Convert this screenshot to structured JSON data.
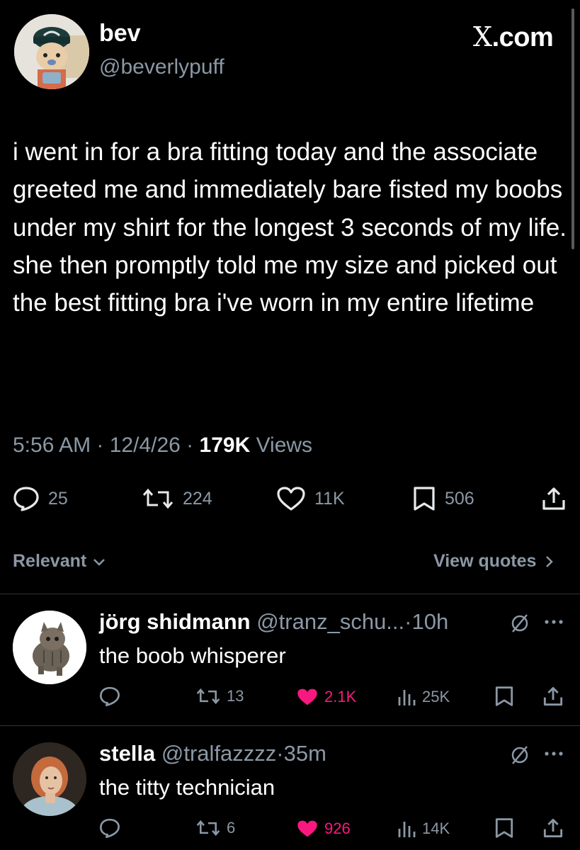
{
  "tweet": {
    "name": "bev",
    "handle": "@beverlypuff",
    "source": "X.com",
    "text": "i went in for a bra fitting today and the associate greeted me and immediately bare fisted my boobs under my shirt for the longest 3 seconds of my life. she then promptly told me my size and picked out the best fitting bra i've worn in my entire lifetime",
    "time": "5:56 AM",
    "date": "12/4/26",
    "views_count": "179K",
    "views_label": "Views",
    "replies": "25",
    "reposts": "224",
    "likes": "11K",
    "bookmarks": "506"
  },
  "filters": {
    "sort_label": "Relevant",
    "view_quotes_label": "View quotes"
  },
  "replies": [
    {
      "name": "jörg shidmann",
      "handle": "@tranz_schu...",
      "time": "10h",
      "text": "the boob whisperer",
      "reposts": "13",
      "likes": "2.1K",
      "views": "25K"
    },
    {
      "name": "stella",
      "handle": "@tralfazzzz",
      "time": "35m",
      "text": "the titty technician",
      "reposts": "6",
      "likes": "926",
      "views": "14K"
    }
  ],
  "colors": {
    "background": "#000000",
    "text": "#ffffff",
    "muted": "#8b98a5",
    "like_pink": "#f91880",
    "divider": "#2f3336"
  }
}
